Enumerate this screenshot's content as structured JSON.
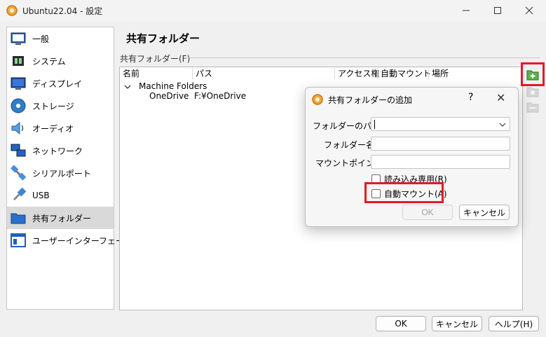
{
  "window": {
    "title": "Ubuntu22.04 - 設定"
  },
  "sidebar": {
    "items": [
      {
        "label": "一般",
        "icon": "general-monitor-icon"
      },
      {
        "label": "システム",
        "icon": "system-chip-icon"
      },
      {
        "label": "ディスプレイ",
        "icon": "display-monitor-icon"
      },
      {
        "label": "ストレージ",
        "icon": "storage-disc-icon"
      },
      {
        "label": "オーディオ",
        "icon": "audio-speaker-icon"
      },
      {
        "label": "ネットワーク",
        "icon": "network-icon"
      },
      {
        "label": "シリアルポート",
        "icon": "serial-port-icon"
      },
      {
        "label": "USB",
        "icon": "usb-icon"
      },
      {
        "label": "共有フォルダー",
        "icon": "shared-folder-icon"
      },
      {
        "label": "ユーザーインターフェース",
        "icon": "user-interface-icon"
      }
    ],
    "selected": "共有フォルダー"
  },
  "page": {
    "title": "共有フォルダー",
    "group_label": "共有フォルダー(F)"
  },
  "list": {
    "columns": [
      "名前",
      "パス",
      "アクセス権",
      "自動マウント",
      "場所"
    ],
    "group": "Machine Folders",
    "rows": [
      {
        "name": "OneDrive",
        "path": "F:¥OneDrive"
      }
    ]
  },
  "buttons": {
    "ok": "OK",
    "cancel": "キャンセル",
    "help": "ヘルプ(H)"
  },
  "dialog": {
    "title": "共有フォルダーの追加",
    "help": "?",
    "close": "✕",
    "path_label": "フォルダーのパス:",
    "path_value": "",
    "name_label": "フォルダー名:",
    "name_value": "",
    "mount_label": "マウントポイント:",
    "mount_value": "",
    "readonly_label": "読み込み専用(R)",
    "automount_label": "自動マウント(A)",
    "ok": "OK",
    "cancel": "キャンセル"
  },
  "colors": {
    "highlight": "#e21b23",
    "selected_bg": "#d9d9d9"
  }
}
